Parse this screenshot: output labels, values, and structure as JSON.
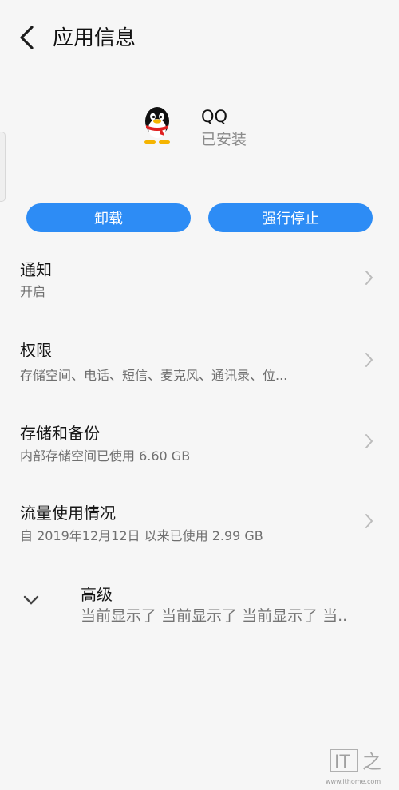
{
  "header": {
    "title": "应用信息",
    "back_icon": "back-arrow-icon"
  },
  "app": {
    "name": "QQ",
    "status": "已安装",
    "icon": "qq-penguin-icon"
  },
  "actions": {
    "uninstall_label": "卸载",
    "force_stop_label": "强行停止"
  },
  "settings": [
    {
      "title": "通知",
      "subtitle": "开启"
    },
    {
      "title": "权限",
      "subtitle": "存储空间、电话、短信、麦克风、通讯录、位..."
    },
    {
      "title": "存储和备份",
      "subtitle": "内部存储空间已使用 6.60 GB"
    },
    {
      "title": "流量使用情况",
      "subtitle": "自 2019年12月12日 以来已使用 2.99 GB"
    }
  ],
  "advanced": {
    "title": "高级",
    "subtitle": "当前显示了 当前显示了 当前显示了 当..",
    "icon": "chevron-down-icon"
  },
  "watermark": {
    "logo": "IT之家",
    "url": "www.ithome.com"
  },
  "colors": {
    "accent": "#2d8cf5",
    "background": "#f6f6f6",
    "secondary_text": "#6f6f6f"
  }
}
